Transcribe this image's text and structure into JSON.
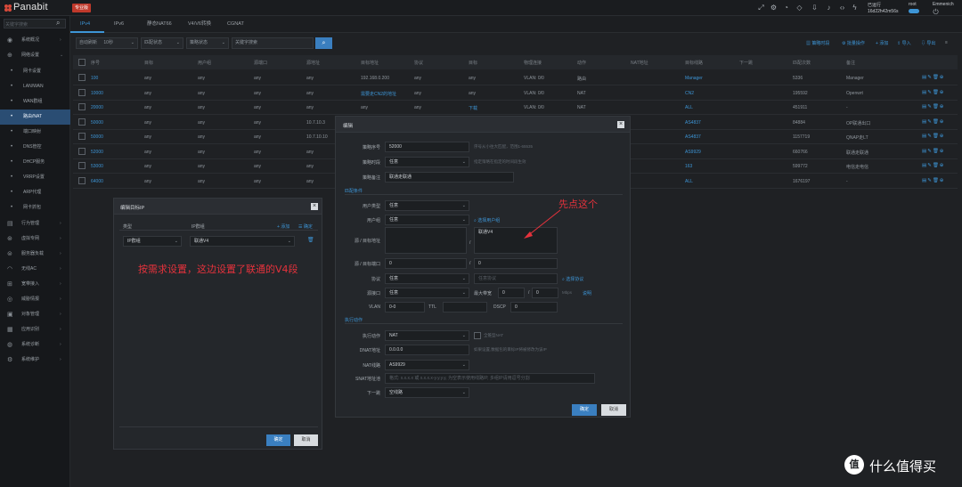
{
  "topbar": {
    "logo": "Panabit",
    "badge": "专业版",
    "status_line1": "已运行",
    "status_line2": "16d22h42m56s",
    "user_name": "root",
    "user_role": "Emmenich"
  },
  "sidebar": {
    "search_placeholder": "关键字搜索",
    "items": [
      {
        "label": "系统概况"
      },
      {
        "label": "网络设置"
      },
      {
        "label": "网卡设置"
      },
      {
        "label": "LAN/WAN"
      },
      {
        "label": "WAN群组"
      },
      {
        "label": "路由/NAT"
      },
      {
        "label": "端口映射"
      },
      {
        "label": "DNS管控"
      },
      {
        "label": "DHCP服务"
      },
      {
        "label": "VRRP设置"
      },
      {
        "label": "ARP代理"
      },
      {
        "label": "网卡抓包"
      },
      {
        "label": "行为管理"
      },
      {
        "label": "虚拟专网"
      },
      {
        "label": "服务器负载"
      },
      {
        "label": "无线AC"
      },
      {
        "label": "宽带接入"
      },
      {
        "label": "威胁情报"
      },
      {
        "label": "对象管理"
      },
      {
        "label": "应用识别"
      },
      {
        "label": "系统诊断"
      },
      {
        "label": "系统维护"
      }
    ]
  },
  "tabs": [
    "IPv4",
    "IPv6",
    "静态NAT66",
    "V4/V6转换",
    "CGNAT"
  ],
  "filter": {
    "refresh_label": "自动刷新",
    "refresh_value": "10秒",
    "sel2": "匹配状态",
    "sel3": "策略状态",
    "keyword_placeholder": "关键字搜索"
  },
  "actions": [
    "策略时段",
    "批量操作",
    "添加",
    "导入",
    "导出"
  ],
  "table": {
    "headers": [
      "序号",
      "目标",
      "用户组",
      "源端口",
      "源地址",
      "目标地址",
      "协议",
      "目标",
      "物理连接",
      "动作",
      "NAT地址",
      "目标线路",
      "下一跳",
      "匹配次数",
      "备注"
    ],
    "rows": [
      [
        "100",
        "any",
        "any",
        "any",
        "any",
        "192.168.0.200",
        "any",
        "any",
        "VLAN: 0/0",
        "路由",
        "",
        "Manager",
        "",
        "5336",
        "Manager"
      ],
      [
        "10000",
        "any",
        "any",
        "any",
        "any",
        "需要走CN2的地址",
        "any",
        "any",
        "VLAN: 0/0",
        "NAT",
        "",
        "CN2",
        "",
        "195592",
        "Openwrt"
      ],
      [
        "20000",
        "any",
        "any",
        "any",
        "any",
        "any",
        "any",
        "下载",
        "VLAN: 0/0",
        "NAT",
        "",
        "ALL",
        "",
        "451911",
        "-"
      ],
      [
        "50000",
        "any",
        "any",
        "any",
        "10.7.10.3",
        "",
        "",
        "",
        "",
        "",
        "",
        "AS4837",
        "",
        "84884",
        "OP联通出口"
      ],
      [
        "50000",
        "any",
        "any",
        "any",
        "10.7.10.10",
        "",
        "",
        "",
        "",
        "",
        "",
        "AS4837",
        "",
        "1157719",
        "QNAP走LT"
      ],
      [
        "52000",
        "any",
        "any",
        "any",
        "any",
        "",
        "",
        "",
        "",
        "",
        "",
        "AS9929",
        "",
        "660766",
        "联通走联通"
      ],
      [
        "53000",
        "any",
        "any",
        "any",
        "any",
        "",
        "",
        "",
        "",
        "",
        "",
        "163",
        "",
        "599772",
        "电信走电信"
      ],
      [
        "64000",
        "any",
        "any",
        "any",
        "any",
        "",
        "",
        "",
        "",
        "",
        "",
        "ALL",
        "",
        "1676197",
        "-"
      ]
    ]
  },
  "dialog_left": {
    "title": "编辑目标IP",
    "col_type": "类型",
    "col_ipgroup": "IP群组",
    "add_label": "+ 添加",
    "confirm_label": "确定",
    "type_value": "IP群组",
    "group_value": "联通V4",
    "ok": "确定",
    "cancel": "取消"
  },
  "dialog_main": {
    "title": "编辑",
    "fields": {
      "seq_label": "策略序号",
      "seq_value": "52000",
      "seq_hint": "序号从小往大匹配，范围1-65535",
      "period_label": "策略时段",
      "period_value": "任意",
      "period_hint": "指定策略在指定的时间段生效",
      "remark_label": "策略备注",
      "remark_value": "联通走联通",
      "match_section": "匹配条件",
      "usertype_label": "用户类型",
      "usertype_value": "任意",
      "usergroup_label": "用户组",
      "usergroup_value": "任意",
      "select_usergroup": "选择用户组",
      "srcdst_label": "源 / 目标地址",
      "dst_value": "联通V4",
      "slash": "/",
      "port_label": "源 / 目标端口",
      "src_port": "0",
      "dst_port": "0",
      "proto_label": "协议",
      "proto_value": "任意",
      "proto_placeholder": "任意协议",
      "select_proto": "选择协议",
      "iface_label": "源接口",
      "iface_value": "任意",
      "maxbw_label": "最大带宽",
      "maxbw1": "0",
      "maxbw2": "0",
      "mbps": "Mbps",
      "desc_link": "说明",
      "vlan_label": "VLAN",
      "vlan_value": "0-0",
      "ttl_label": "TTL",
      "dscp_label": "DSCP",
      "dscp_value": "0",
      "action_section": "执行动作",
      "action_label": "执行动作",
      "action_value": "NAT",
      "full_nat": "全锥型NAT",
      "dnat_label": "DNAT地址",
      "dnat_value": "0.0.0.0",
      "dnat_hint": "如果设置,数据包的目标IP将被修改为该IP",
      "natline_label": "NAT线路",
      "natline_value": "AS9929",
      "snat_label": "SNAT地址池",
      "snat_placeholder": "格式: x.x.x.x 或 x.x.x.x-y.y.y.y, 为空表示使用线路IP, 多组IP请用逗号分割",
      "nexthop_label": "下一跳",
      "nexthop_value": "空线路"
    },
    "ok": "确定",
    "cancel": "取消"
  },
  "annotations": {
    "first": "先点这个",
    "second": "按需求设置，这边设置了联通的V4段"
  },
  "watermark": {
    "icon": "值",
    "text": "什么值得买"
  }
}
